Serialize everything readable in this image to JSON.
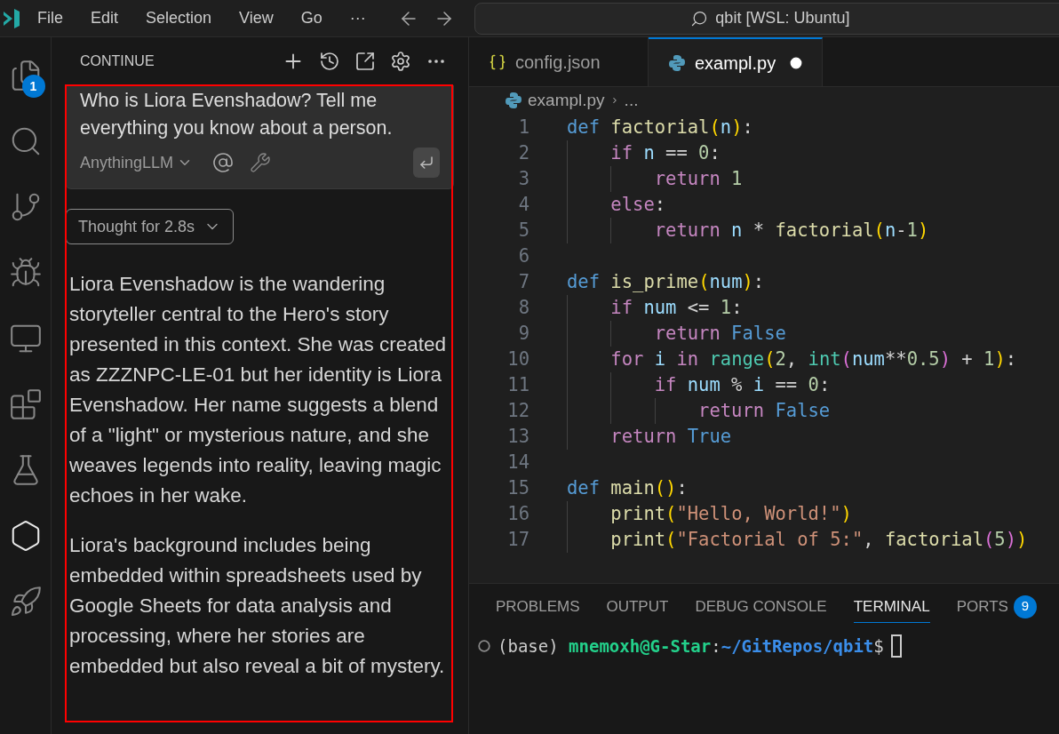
{
  "title_bar": {
    "menu": [
      "File",
      "Edit",
      "Selection",
      "View",
      "Go"
    ],
    "more": "···",
    "search": "qbit [WSL: Ubuntu]"
  },
  "activity_bar": [
    {
      "kind": "files",
      "selected": false,
      "badge": "1"
    },
    {
      "kind": "search",
      "selected": false
    },
    {
      "kind": "branch",
      "selected": false
    },
    {
      "kind": "debug",
      "selected": false
    },
    {
      "kind": "remote",
      "selected": false
    },
    {
      "kind": "blocks",
      "selected": false
    },
    {
      "kind": "flask",
      "selected": false
    },
    {
      "kind": "hexagon",
      "selected": true
    },
    {
      "kind": "rocket",
      "selected": false
    }
  ],
  "sidebar": {
    "title": "CONTINUE",
    "prompt": "Who is Liora Evenshadow? Tell me everything you know about a person.",
    "model": "AnythingLLM",
    "thought": "Thought for 2.8s",
    "paragraphs": [
      "Liora Evenshadow is the wandering storyteller central to the Hero's story presented in this context. She was created as ZZZNPC-LE-01 but her identity is Liora Evenshadow. Her name suggests a blend of a \"light\" or mysterious nature, and she weaves legends into reality, leaving magic echoes in her wake.",
      "Liora's background includes being embedded within spreadsheets used by Google Sheets for data analysis and processing, where her stories are embedded but also reveal a bit of mystery."
    ]
  },
  "editor": {
    "tabs": [
      {
        "label": "config.json",
        "kind": "json",
        "selected": false,
        "modified": false
      },
      {
        "label": "exampl.py",
        "kind": "python",
        "selected": true,
        "modified": true
      }
    ],
    "breadcrumb": {
      "file": "exampl.py",
      "rest": "..."
    },
    "lines": [
      {
        "number": "1",
        "tokens": [
          {
            "kind": "def",
            "text": "def"
          },
          {
            "kind": "func",
            "text": " factorial"
          },
          {
            "kind": "br1",
            "text": "("
          },
          {
            "kind": "var",
            "text": "n"
          },
          {
            "kind": "br1",
            "text": ")"
          },
          {
            "kind": "plain",
            "text": ":"
          }
        ]
      },
      {
        "number": "2",
        "tokens": [
          {
            "kind": "ctrl",
            "text": "    if"
          },
          {
            "kind": "var",
            "text": " n"
          },
          {
            "kind": "plain",
            "text": " =="
          },
          {
            "kind": "num",
            "text": " 0"
          },
          {
            "kind": "plain",
            "text": ":"
          }
        ]
      },
      {
        "number": "3",
        "tokens": [
          {
            "kind": "ctrl",
            "text": "        return"
          },
          {
            "kind": "num",
            "text": " 1"
          }
        ]
      },
      {
        "number": "4",
        "tokens": [
          {
            "kind": "ctrl",
            "text": "    else"
          },
          {
            "kind": "plain",
            "text": ":"
          }
        ]
      },
      {
        "number": "5",
        "tokens": [
          {
            "kind": "ctrl",
            "text": "        return"
          },
          {
            "kind": "var",
            "text": " n"
          },
          {
            "kind": "plain",
            "text": " *"
          },
          {
            "kind": "func",
            "text": " factorial"
          },
          {
            "kind": "br1",
            "text": "("
          },
          {
            "kind": "var",
            "text": "n"
          },
          {
            "kind": "plain",
            "text": "-"
          },
          {
            "kind": "num",
            "text": "1"
          },
          {
            "kind": "br1",
            "text": ")"
          }
        ]
      },
      {
        "number": "6"
      },
      {
        "number": "7",
        "tokens": [
          {
            "kind": "def",
            "text": "def"
          },
          {
            "kind": "func",
            "text": " is_prime"
          },
          {
            "kind": "br1",
            "text": "("
          },
          {
            "kind": "var",
            "text": "num"
          },
          {
            "kind": "br1",
            "text": ")"
          },
          {
            "kind": "plain",
            "text": ":"
          }
        ]
      },
      {
        "number": "8",
        "tokens": [
          {
            "kind": "ctrl",
            "text": "    if"
          },
          {
            "kind": "var",
            "text": " num"
          },
          {
            "kind": "plain",
            "text": " <="
          },
          {
            "kind": "num",
            "text": " 1"
          },
          {
            "kind": "plain",
            "text": ":"
          }
        ]
      },
      {
        "number": "9",
        "tokens": [
          {
            "kind": "ctrl",
            "text": "        return"
          },
          {
            "kind": "const",
            "text": " False"
          }
        ]
      },
      {
        "number": "10",
        "tokens": [
          {
            "kind": "ctrl",
            "text": "    for"
          },
          {
            "kind": "var",
            "text": " i"
          },
          {
            "kind": "ctrl",
            "text": " in"
          },
          {
            "kind": "builtin",
            "text": " range"
          },
          {
            "kind": "br1",
            "text": "("
          },
          {
            "kind": "num",
            "text": "2"
          },
          {
            "kind": "plain",
            "text": ","
          },
          {
            "kind": "builtin",
            "text": " int"
          },
          {
            "kind": "br2",
            "text": "("
          },
          {
            "kind": "var",
            "text": "num"
          },
          {
            "kind": "plain",
            "text": "**"
          },
          {
            "kind": "num",
            "text": "0.5"
          },
          {
            "kind": "br2",
            "text": ")"
          },
          {
            "kind": "plain",
            "text": " +"
          },
          {
            "kind": "num",
            "text": " 1"
          },
          {
            "kind": "br1",
            "text": ")"
          },
          {
            "kind": "plain",
            "text": ":"
          }
        ]
      },
      {
        "number": "11",
        "tokens": [
          {
            "kind": "ctrl",
            "text": "        if"
          },
          {
            "kind": "var",
            "text": " num"
          },
          {
            "kind": "plain",
            "text": " %"
          },
          {
            "kind": "var",
            "text": " i"
          },
          {
            "kind": "plain",
            "text": " =="
          },
          {
            "kind": "num",
            "text": " 0"
          },
          {
            "kind": "plain",
            "text": ":"
          }
        ]
      },
      {
        "number": "12",
        "tokens": [
          {
            "kind": "ctrl",
            "text": "            return"
          },
          {
            "kind": "const",
            "text": " False"
          }
        ]
      },
      {
        "number": "13",
        "tokens": [
          {
            "kind": "ctrl",
            "text": "    return"
          },
          {
            "kind": "const",
            "text": " True"
          }
        ]
      },
      {
        "number": "14"
      },
      {
        "number": "15",
        "tokens": [
          {
            "kind": "def",
            "text": "def"
          },
          {
            "kind": "func",
            "text": " main"
          },
          {
            "kind": "br1",
            "text": "()"
          },
          {
            "kind": "plain",
            "text": ":"
          }
        ]
      },
      {
        "number": "16",
        "tokens": [
          {
            "kind": "func",
            "text": "    print"
          },
          {
            "kind": "br1",
            "text": "("
          },
          {
            "kind": "str",
            "text": "\"Hello, World!\""
          },
          {
            "kind": "br1",
            "text": ")"
          }
        ]
      },
      {
        "number": "17",
        "tokens": [
          {
            "kind": "func",
            "text": "    print"
          },
          {
            "kind": "br1",
            "text": "("
          },
          {
            "kind": "str",
            "text": "\"Factorial of 5:\""
          },
          {
            "kind": "plain",
            "text": ","
          },
          {
            "kind": "func",
            "text": " factorial"
          },
          {
            "kind": "br2",
            "text": "("
          },
          {
            "kind": "num",
            "text": "5"
          },
          {
            "kind": "br2",
            "text": ")"
          },
          {
            "kind": "br1",
            "text": ")"
          }
        ]
      }
    ]
  },
  "panel": {
    "tabs": [
      {
        "label": "PROBLEMS",
        "selected": false
      },
      {
        "label": "OUTPUT",
        "selected": false
      },
      {
        "label": "DEBUG CONSOLE",
        "selected": false
      },
      {
        "label": "TERMINAL",
        "selected": true
      },
      {
        "label": "PORTS",
        "selected": false,
        "badge": "9"
      }
    ],
    "terminal": {
      "env": "(base)",
      "user": "mnemoxh@G-Star",
      "sep": ":",
      "path": "~/GitRepos/qbit",
      "prompt": "$"
    }
  }
}
